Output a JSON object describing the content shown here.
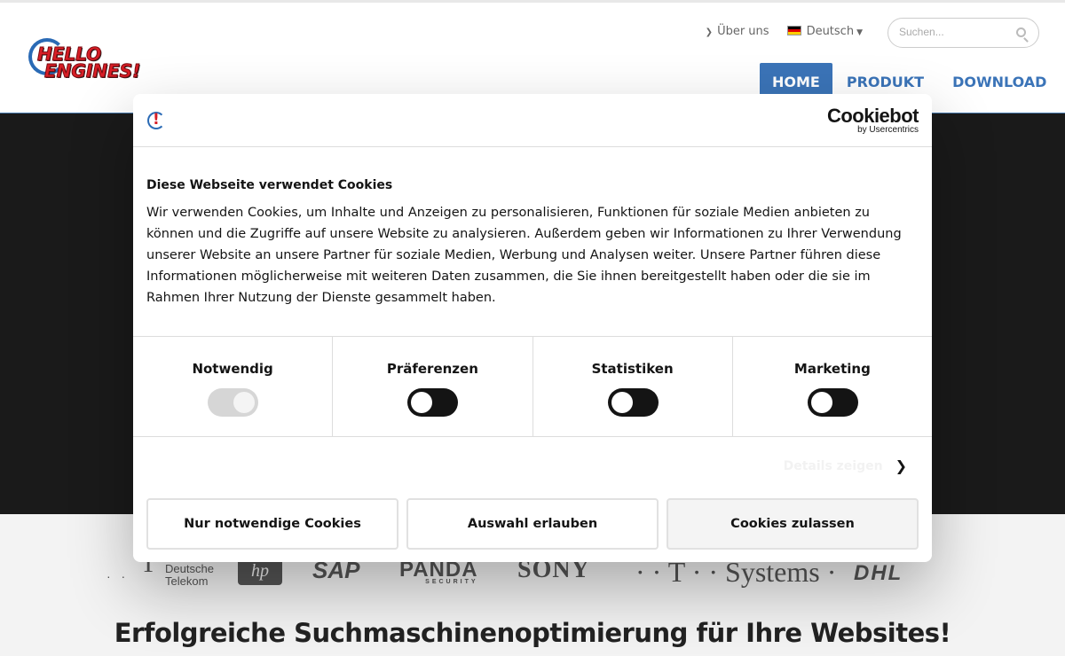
{
  "header": {
    "logo": {
      "line1": "HELLO",
      "line2": "ENGINES!"
    },
    "top_links": {
      "about": "Über uns",
      "language": "Deutsch"
    },
    "search": {
      "placeholder": "Suchen..."
    },
    "nav": [
      {
        "label": "HOME",
        "active": true
      },
      {
        "label": "PRODUKT",
        "active": false
      },
      {
        "label": "DOWNLOAD",
        "active": false
      }
    ]
  },
  "partners": {
    "telekom": {
      "mark": "T",
      "line1": "Deutsche",
      "line2": "Telekom"
    },
    "hp": "hp",
    "sap": "SAP",
    "panda": {
      "name": "PANDA",
      "sub": "SECURITY"
    },
    "sony": "SONY",
    "tsystems": "· · T · · Systems ·",
    "dhl": "DHL"
  },
  "tagline": "Erfolgreiche Suchmaschinenoptimierung für Ihre Websites!",
  "cookie_dialog": {
    "brand": {
      "name": "Cookiebot",
      "sub": "by Usercentrics"
    },
    "title": "Diese Webseite verwendet Cookies",
    "text": "Wir verwenden Cookies, um Inhalte und Anzeigen zu personalisieren, Funktionen für soziale Medien anbieten zu können und die Zugriffe auf unsere Website zu analysieren. Außerdem geben wir Informationen zu Ihrer Verwendung unserer Website an unsere Partner für soziale Medien, Werbung und Analysen weiter. Unsere Partner führen diese Informationen möglicherweise mit weiteren Daten zusammen, die Sie ihnen bereitgestellt haben oder die sie im Rahmen Ihrer Nutzung der Dienste gesammelt haben.",
    "categories": [
      {
        "label": "Notwendig",
        "state": "on-locked"
      },
      {
        "label": "Präferenzen",
        "state": "off"
      },
      {
        "label": "Statistiken",
        "state": "off"
      },
      {
        "label": "Marketing",
        "state": "off"
      }
    ],
    "details_label": "Details zeigen",
    "buttons": {
      "necessary": "Nur notwendige Cookies",
      "selection": "Auswahl erlauben",
      "allow_all": "Cookies zulassen"
    }
  },
  "colors": {
    "brand_blue": "#3b74b8",
    "logo_red": "#d81e26",
    "hero_bg": "#1a1a1a"
  }
}
